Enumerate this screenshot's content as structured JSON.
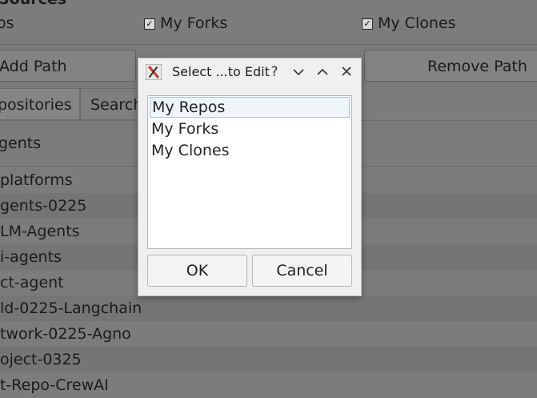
{
  "background": {
    "section_title": "Sources",
    "checkboxes": [
      {
        "label": "os",
        "checked": null
      },
      {
        "label": "My Forks",
        "checked": true
      },
      {
        "label": "My Clones",
        "checked": true
      }
    ],
    "add_path_label": "Add Path",
    "remove_path_label": "Remove Path",
    "tabs": [
      "positories",
      "Search"
    ],
    "filter_text": "gents",
    "repo_rows": [
      "platforms",
      "gents-0225",
      "LM-Agents",
      "i-agents",
      "ct-agent",
      "ld-0225-Langchain",
      "twork-0225-Agno",
      "oject-0325",
      "t-Repo-CrewAI"
    ]
  },
  "dialog": {
    "title": "Select ...to Edit",
    "help_glyph": "?",
    "minimize_glyph": "⌄",
    "maximize_glyph": "⌃",
    "close_glyph": "✕",
    "items": [
      "My Repos",
      "My Forks",
      "My Clones"
    ],
    "selected_index": 0,
    "ok_label": "OK",
    "cancel_label": "Cancel"
  }
}
